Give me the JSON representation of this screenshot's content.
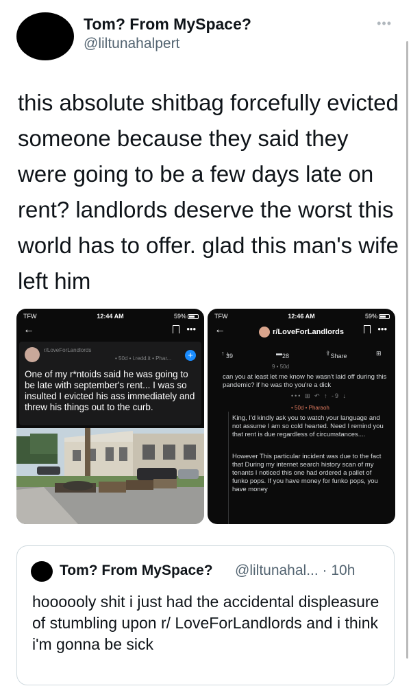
{
  "tweet": {
    "display_name": "Tom? From MySpace?",
    "handle": "@liltunahalpert",
    "more": "•••",
    "text": "this absolute shitbag forcefully evicted someone because they said they were going to be a few days late on rent? landlords deserve the worst this world has to offer. glad this man's wife left him"
  },
  "screenshot_left": {
    "carrier": "TFW",
    "time": "12:44 AM",
    "battery": "59%",
    "back": "←",
    "more": "•••",
    "subreddit": "r/LoveForLandlords",
    "meta": "• 50d • i.redd.it • Phar...",
    "join": "+",
    "title": "One of my r*ntoids said he was going to be late with september's rent... I was so insulted I evicted his ass immediately and threw his things out to the curb."
  },
  "screenshot_right": {
    "carrier": "TFW",
    "time": "12:46 AM",
    "battery": "59%",
    "back": "←",
    "more": "•••",
    "subreddit": "r/LoveForLandlords",
    "upvotes": "39",
    "comments": "28",
    "share": "Share",
    "comment1_meta": "9 • 50d",
    "comment1_text": "can you at least let me know he wasn't laid off during this pandemic? if he was tho you're a dick",
    "reply_tools": "••• ⊞ ↶ ↑ -9 ↓",
    "comment2_meta": "• 50d • Pharaoh",
    "comment2_text1": "King, I'd kindly ask you to watch your language and not assume I am so cold hearted. Need I remind you that rent is due regardless of circumstances....",
    "comment2_text2": "However This particular incident was due to the fact that During my internet search history scan of my tenants I noticed this one had ordered a pallet of funko pops. If you have money for funko pops, you have money"
  },
  "quote": {
    "display_name": "Tom? From MySpace?",
    "handle_time": "@liltunahal... · 10h",
    "text": "hoooooly shit i just had the accidental displeasure of stumbling upon r/ LoveForLandlords and i think i'm gonna be sick"
  }
}
